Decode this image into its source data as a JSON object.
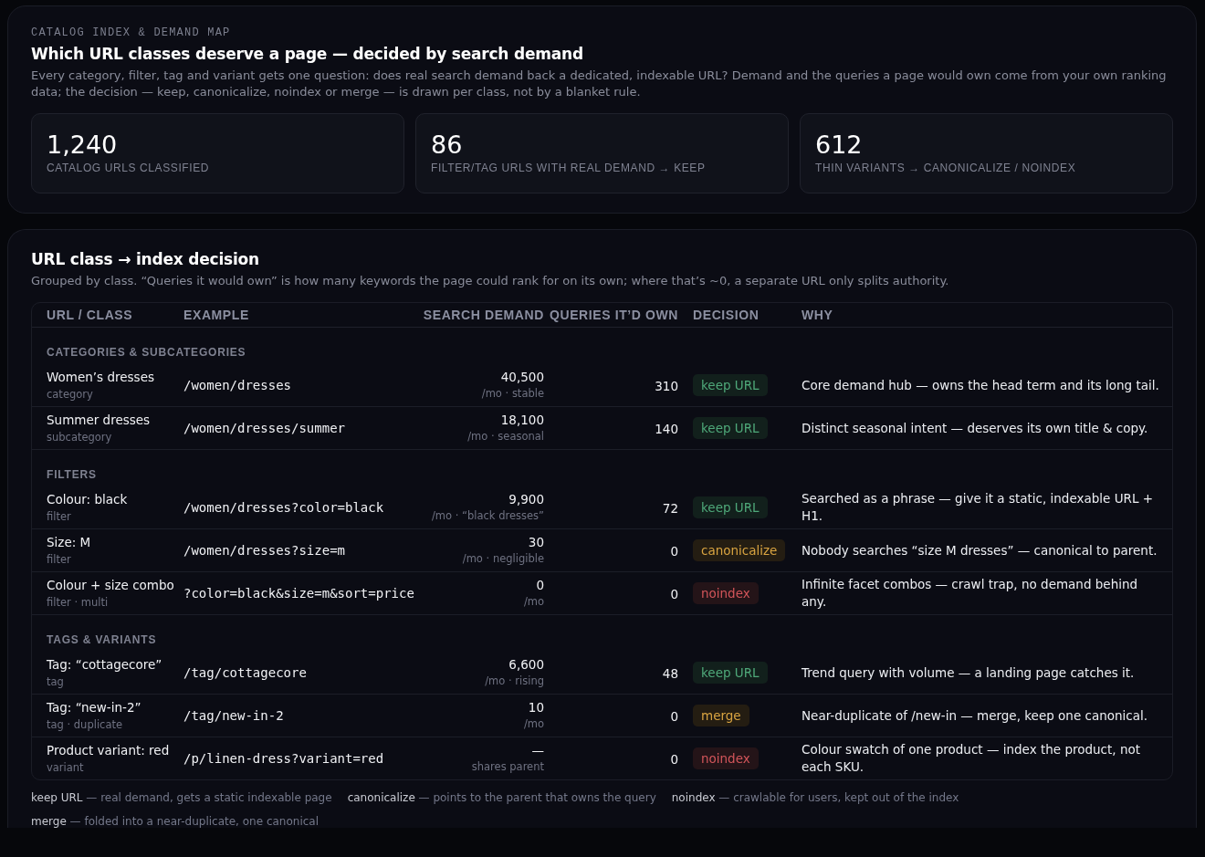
{
  "header": {
    "eyebrow": "CATALOG INDEX & DEMAND MAP",
    "title": "Which URL classes deserve a page — decided by search demand",
    "description": "Every category, filter, tag and variant gets one question: does real search demand back a dedicated, indexable URL? Demand and the queries a page would own come from your own ranking data; the decision — keep, canonicalize, noindex or merge — is drawn per class, not by a blanket rule."
  },
  "stats": [
    {
      "value": "1,240",
      "label": "CATALOG URLS CLASSIFIED"
    },
    {
      "value": "86",
      "label": "FILTER/TAG URLS WITH REAL DEMAND → KEEP"
    },
    {
      "value": "612",
      "label": "THIN VARIANTS → CANONICALIZE / NOINDEX"
    }
  ],
  "table": {
    "title": "URL class → index decision",
    "description": "Grouped by class. “Queries it would own” is how many keywords the page could rank for on its own; where that’s ~0, a separate URL only splits authority.",
    "columns": [
      "URL / CLASS",
      "EXAMPLE",
      "SEARCH DEMAND",
      "QUERIES IT’D OWN",
      "DECISION",
      "WHY"
    ],
    "groups": [
      {
        "title": "CATEGORIES & SUBCATEGORIES",
        "rows": [
          {
            "name": "Women’s dresses",
            "class": "category",
            "example": "/women/dresses",
            "demand": "40,500",
            "demand_note": "/mo · stable",
            "queries": "310",
            "decision": {
              "kind": "keep",
              "label": "keep URL"
            },
            "why": "Core demand hub — owns the head term and its long tail."
          },
          {
            "name": "Summer dresses",
            "class": "subcategory",
            "example": "/women/dresses/summer",
            "demand": "18,100",
            "demand_note": "/mo · seasonal",
            "queries": "140",
            "decision": {
              "kind": "keep",
              "label": "keep URL"
            },
            "why": "Distinct seasonal intent — deserves its own title & copy."
          }
        ]
      },
      {
        "title": "FILTERS",
        "rows": [
          {
            "name": "Colour: black",
            "class": "filter",
            "example": "/women/dresses?color=black",
            "demand": "9,900",
            "demand_note": "/mo · “black dresses”",
            "queries": "72",
            "decision": {
              "kind": "keep",
              "label": "keep URL"
            },
            "why": "Searched as a phrase — give it a static, indexable URL + H1."
          },
          {
            "name": "Size: M",
            "class": "filter",
            "example": "/women/dresses?size=m",
            "demand": "30",
            "demand_note": "/mo · negligible",
            "queries": "0",
            "decision": {
              "kind": "canonicalize",
              "label": "canonicalize"
            },
            "why": "Nobody searches “size M dresses” — canonical to parent."
          },
          {
            "name": "Colour + size combo",
            "class": "filter · multi",
            "example": "?color=black&size=m&sort=price",
            "demand": "0",
            "demand_note": "/mo",
            "queries": "0",
            "decision": {
              "kind": "noindex",
              "label": "noindex"
            },
            "why": "Infinite facet combos — crawl trap, no demand behind any."
          }
        ]
      },
      {
        "title": "TAGS & VARIANTS",
        "rows": [
          {
            "name": "Tag: “cottagecore”",
            "class": "tag",
            "example": "/tag/cottagecore",
            "demand": "6,600",
            "demand_note": "/mo · rising",
            "queries": "48",
            "decision": {
              "kind": "keep",
              "label": "keep URL"
            },
            "why": "Trend query with volume — a landing page catches it."
          },
          {
            "name": "Tag: “new-in-2”",
            "class": "tag · duplicate",
            "example": "/tag/new-in-2",
            "demand": "10",
            "demand_note": "/mo",
            "queries": "0",
            "decision": {
              "kind": "merge",
              "label": "merge"
            },
            "why": "Near-duplicate of /new-in — merge, keep one canonical."
          },
          {
            "name": "Product variant: red",
            "class": "variant",
            "example": "/p/linen-dress?variant=red",
            "demand": "—",
            "demand_note": "shares parent",
            "queries": "0",
            "decision": {
              "kind": "noindex",
              "label": "noindex"
            },
            "why": "Colour swatch of one product — index the product, not each SKU."
          }
        ]
      }
    ]
  },
  "legend": [
    "**keep URL** — real demand, gets a static indexable page",
    "**canonicalize** — points to the parent that owns the query",
    "**noindex** — crawlable for users, kept out of the index",
    "**merge** — folded into a near-duplicate, one canonical"
  ]
}
